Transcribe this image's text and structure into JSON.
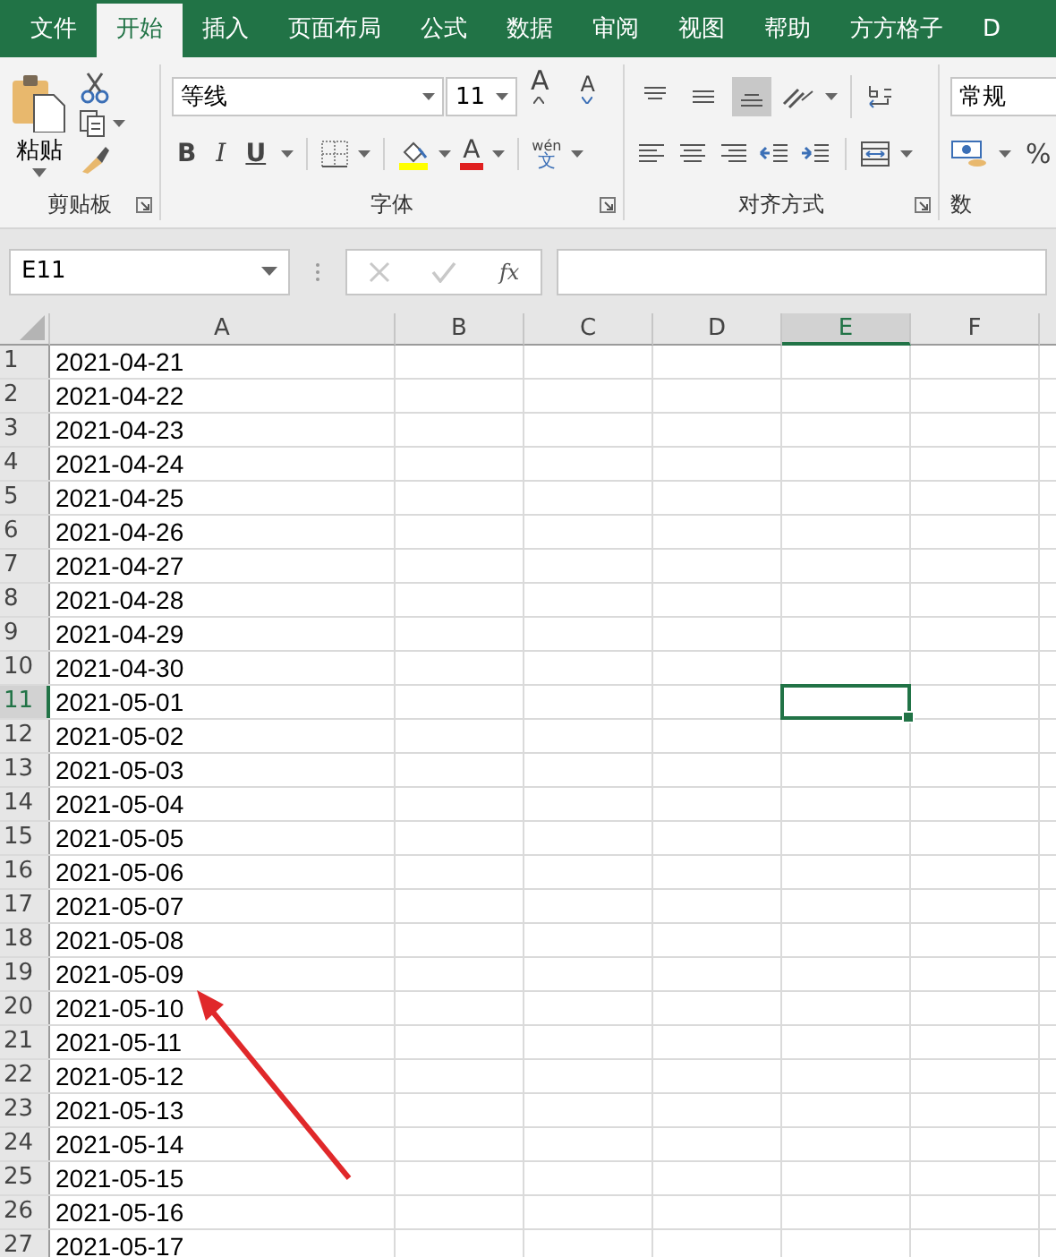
{
  "tabs": [
    {
      "label": "文件",
      "selected": false
    },
    {
      "label": "开始",
      "selected": true
    },
    {
      "label": "插入",
      "selected": false
    },
    {
      "label": "页面布局",
      "selected": false
    },
    {
      "label": "公式",
      "selected": false
    },
    {
      "label": "数据",
      "selected": false
    },
    {
      "label": "审阅",
      "selected": false
    },
    {
      "label": "视图",
      "selected": false
    },
    {
      "label": "帮助",
      "selected": false
    },
    {
      "label": "方方格子",
      "selected": false
    },
    {
      "label": "D",
      "selected": false
    }
  ],
  "ribbon": {
    "clipboard": {
      "paste_label": "粘贴",
      "group_label": "剪贴板"
    },
    "font": {
      "name": "等线",
      "size": "11",
      "grow_label": "A",
      "shrink_label": "A",
      "bold": "B",
      "italic": "I",
      "underline": "U",
      "font_color": "A",
      "phonetic_top": "wén",
      "phonetic_bottom": "文",
      "group_label": "字体"
    },
    "alignment": {
      "vertical_align": [
        {
          "selected": false
        },
        {
          "selected": false
        },
        {
          "selected": true
        }
      ],
      "group_label": "对齐方式"
    },
    "number": {
      "format": "常规",
      "percent": "%",
      "group_label": "数"
    }
  },
  "formula_bar": {
    "name_box": "E11",
    "function_label": "fx"
  },
  "sheet": {
    "columns": [
      {
        "label": "A",
        "selected": false
      },
      {
        "label": "B",
        "selected": false
      },
      {
        "label": "C",
        "selected": false
      },
      {
        "label": "D",
        "selected": false
      },
      {
        "label": "E",
        "selected": true
      },
      {
        "label": "F",
        "selected": false
      }
    ],
    "rows": [
      {
        "number": "1",
        "a": "2021-04-21",
        "selected": false
      },
      {
        "number": "2",
        "a": "2021-04-22",
        "selected": false
      },
      {
        "number": "3",
        "a": "2021-04-23",
        "selected": false
      },
      {
        "number": "4",
        "a": "2021-04-24",
        "selected": false
      },
      {
        "number": "5",
        "a": "2021-04-25",
        "selected": false
      },
      {
        "number": "6",
        "a": "2021-04-26",
        "selected": false
      },
      {
        "number": "7",
        "a": "2021-04-27",
        "selected": false
      },
      {
        "number": "8",
        "a": "2021-04-28",
        "selected": false
      },
      {
        "number": "9",
        "a": "2021-04-29",
        "selected": false
      },
      {
        "number": "10",
        "a": "2021-04-30",
        "selected": false
      },
      {
        "number": "11",
        "a": "2021-05-01",
        "selected": true
      },
      {
        "number": "12",
        "a": "2021-05-02",
        "selected": false
      },
      {
        "number": "13",
        "a": "2021-05-03",
        "selected": false
      },
      {
        "number": "14",
        "a": "2021-05-04",
        "selected": false
      },
      {
        "number": "15",
        "a": "2021-05-05",
        "selected": false
      },
      {
        "number": "16",
        "a": "2021-05-06",
        "selected": false
      },
      {
        "number": "17",
        "a": "2021-05-07",
        "selected": false
      },
      {
        "number": "18",
        "a": "2021-05-08",
        "selected": false
      },
      {
        "number": "19",
        "a": "2021-05-09",
        "selected": false
      },
      {
        "number": "20",
        "a": "2021-05-10",
        "selected": false
      },
      {
        "number": "21",
        "a": "2021-05-11",
        "selected": false
      },
      {
        "number": "22",
        "a": "2021-05-12",
        "selected": false
      },
      {
        "number": "23",
        "a": "2021-05-13",
        "selected": false
      },
      {
        "number": "24",
        "a": "2021-05-14",
        "selected": false
      },
      {
        "number": "25",
        "a": "2021-05-15",
        "selected": false
      },
      {
        "number": "26",
        "a": "2021-05-16",
        "selected": false
      },
      {
        "number": "27",
        "a": "2021-05-17",
        "selected": false
      }
    ]
  }
}
